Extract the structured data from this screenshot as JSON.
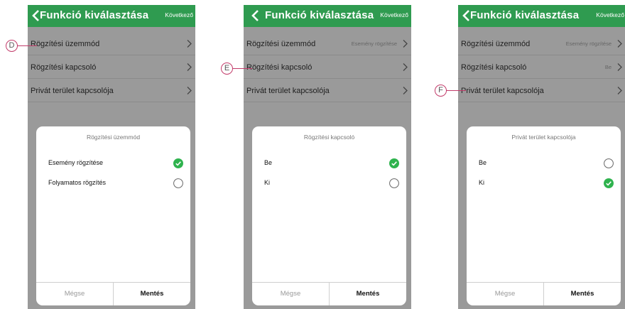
{
  "colors": {
    "header": "#2f9b50",
    "check": "#2fb34e",
    "callout": "#c23b6a"
  },
  "screens": [
    {
      "header": {
        "title": "Funkció kiválasztása",
        "next": "Következő"
      },
      "rows": [
        {
          "label": "Rögzítési üzemmód",
          "value": ""
        },
        {
          "label": "Rögzítési kapcsoló",
          "value": ""
        },
        {
          "label": "Privát terület kapcsolója",
          "value": ""
        }
      ],
      "sheet": {
        "title": "Rögzítési üzemmód",
        "options": [
          {
            "label": "Esemény rögzítése",
            "selected": true
          },
          {
            "label": "Folyamatos rögzítés",
            "selected": false
          }
        ],
        "cancel": "Mégse",
        "save": "Mentés"
      },
      "callout": "D"
    },
    {
      "header": {
        "title": "Funkció kiválasztása",
        "next": "Következő"
      },
      "rows": [
        {
          "label": "Rögzítési üzemmód",
          "value": "Esemény rögzítése"
        },
        {
          "label": "Rögzítési kapcsoló",
          "value": ""
        },
        {
          "label": "Privát terület kapcsolója",
          "value": ""
        }
      ],
      "sheet": {
        "title": "Rögzítési kapcsoló",
        "options": [
          {
            "label": "Be",
            "selected": true
          },
          {
            "label": "Ki",
            "selected": false
          }
        ],
        "cancel": "Mégse",
        "save": "Mentés"
      },
      "callout": "E"
    },
    {
      "header": {
        "title": "Funkció kiválasztása",
        "next": "Következő"
      },
      "rows": [
        {
          "label": "Rögzítési üzemmód",
          "value": "Esemény rögzítése"
        },
        {
          "label": "Rögzítési kapcsoló",
          "value": "Be"
        },
        {
          "label": "Privát terület kapcsolója",
          "value": ""
        }
      ],
      "sheet": {
        "title": "Privát terület kapcsolója",
        "options": [
          {
            "label": "Be",
            "selected": false
          },
          {
            "label": "Ki",
            "selected": true
          }
        ],
        "cancel": "Mégse",
        "save": "Mentés"
      },
      "callout": "F"
    }
  ]
}
